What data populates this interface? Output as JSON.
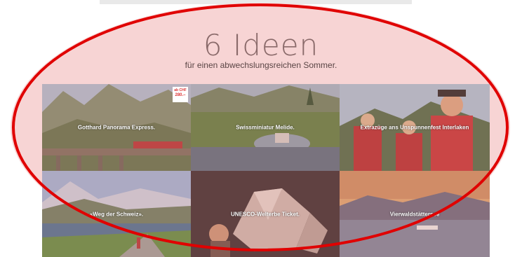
{
  "header": {
    "title": "6 Ideen",
    "subtitle": "für einen abwechslungsreichen Sommer."
  },
  "tiles": [
    {
      "label": "Gotthard Panorama Express.",
      "badge_small": "ab CHF",
      "badge_price": "280.–"
    },
    {
      "label": "Swissminiatur Melide."
    },
    {
      "label": "Extrazüge ans Unspunnenfest Interlaken"
    },
    {
      "label": "«Weg der Schweiz»."
    },
    {
      "label": "UNESCO-Welterbe Ticket."
    },
    {
      "label": "Vierwaldstättersee"
    }
  ],
  "colors": {
    "annotation_ring": "#e00000",
    "overlay_tint": "#f4c8c8"
  }
}
